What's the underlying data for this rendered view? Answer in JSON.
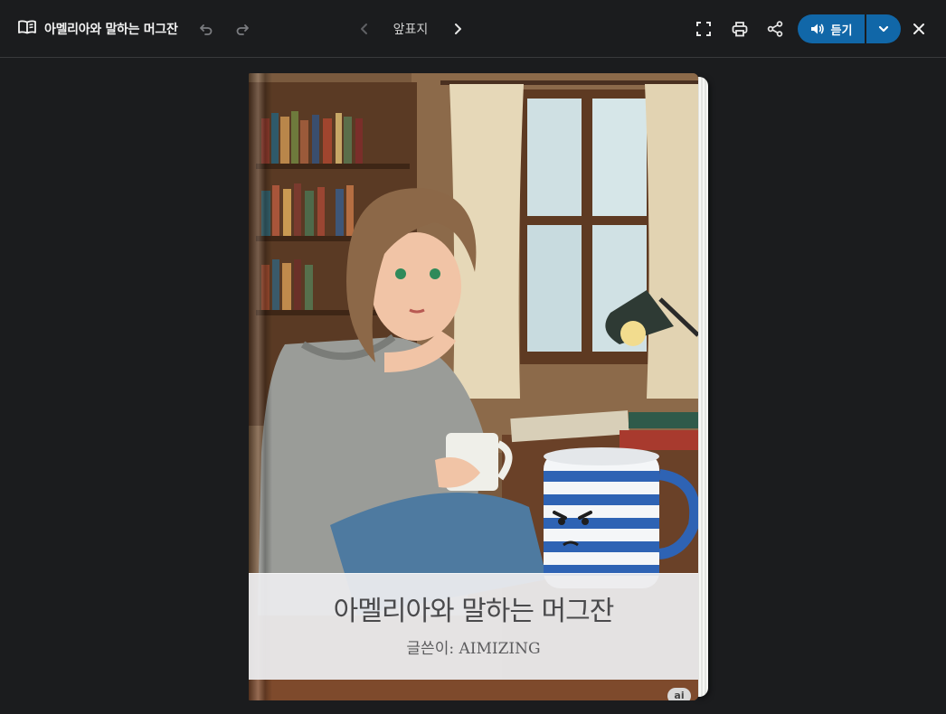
{
  "header": {
    "title": "아멜리아와 말하는 머그잔",
    "nav_label": "앞표지",
    "listen_label": "듣기"
  },
  "book": {
    "title": "아멜리아와 말하는 머그잔",
    "author": "글쓴이: AIMIZING",
    "badge": "ai"
  },
  "icons": {
    "book": "book-open-icon",
    "undo": "undo-icon",
    "redo": "redo-icon",
    "prev": "chevron-left-icon",
    "next": "chevron-right-icon",
    "fullscreen": "fullscreen-icon",
    "print": "printer-icon",
    "share": "share-icon",
    "speaker": "speaker-icon",
    "dropdown": "chevron-down-icon",
    "close": "close-icon"
  },
  "colors": {
    "background": "#1b1c1e",
    "accent": "#1167a8"
  }
}
